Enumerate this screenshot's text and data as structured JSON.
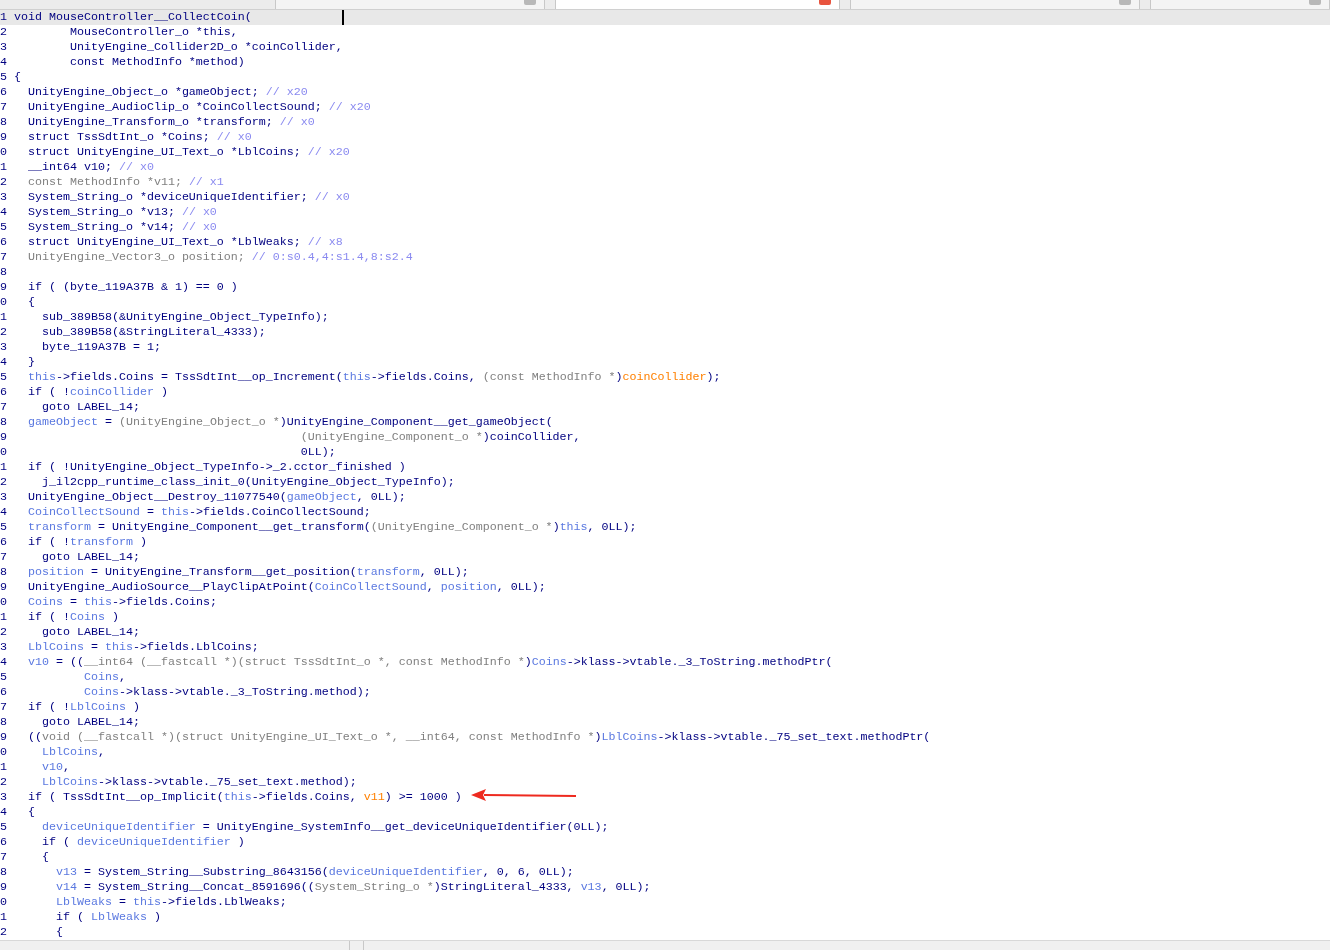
{
  "tabs": [
    {
      "selected": false
    },
    {
      "selected": true
    },
    {
      "selected": false
    },
    {
      "selected": false
    }
  ],
  "lines": [
    {
      "number": "1",
      "current": true,
      "segments": [
        {
          "kind": "plain",
          "text": "void MouseController__CollectCoin("
        }
      ]
    },
    {
      "number": "2",
      "current": false,
      "segments": [
        {
          "kind": "plain",
          "text": "        MouseController_o *this,"
        }
      ]
    },
    {
      "number": "3",
      "current": false,
      "segments": [
        {
          "kind": "plain",
          "text": "        UnityEngine_Collider2D_o *coinCollider,"
        }
      ]
    },
    {
      "number": "4",
      "current": false,
      "segments": [
        {
          "kind": "plain",
          "text": "        const MethodInfo *method)"
        }
      ]
    },
    {
      "number": "5",
      "current": false,
      "segments": [
        {
          "kind": "plain",
          "text": "{"
        }
      ]
    },
    {
      "number": "6",
      "current": false,
      "segments": [
        {
          "kind": "plain",
          "text": "  UnityEngine_Object_o *gameObject; "
        },
        {
          "kind": "comment",
          "text": "// x20"
        }
      ]
    },
    {
      "number": "7",
      "current": false,
      "segments": [
        {
          "kind": "plain",
          "text": "  UnityEngine_AudioClip_o *CoinCollectSound; "
        },
        {
          "kind": "comment",
          "text": "// x20"
        }
      ]
    },
    {
      "number": "8",
      "current": false,
      "segments": [
        {
          "kind": "plain",
          "text": "  UnityEngine_Transform_o *transform; "
        },
        {
          "kind": "comment",
          "text": "// x0"
        }
      ]
    },
    {
      "number": "9",
      "current": false,
      "segments": [
        {
          "kind": "plain",
          "text": "  struct TssSdtInt_o *Coins; "
        },
        {
          "kind": "comment",
          "text": "// x0"
        }
      ]
    },
    {
      "number": "0",
      "current": false,
      "segments": [
        {
          "kind": "plain",
          "text": "  struct UnityEngine_UI_Text_o *LblCoins; "
        },
        {
          "kind": "comment",
          "text": "// x20"
        }
      ]
    },
    {
      "number": "1",
      "current": false,
      "segments": [
        {
          "kind": "plain",
          "text": "  __int64 v10; "
        },
        {
          "kind": "comment",
          "text": "// x0"
        }
      ]
    },
    {
      "number": "2",
      "current": false,
      "segments": [
        {
          "kind": "gray",
          "text": "  const MethodInfo *v11; "
        },
        {
          "kind": "comment",
          "text": "// x1"
        }
      ]
    },
    {
      "number": "3",
      "current": false,
      "segments": [
        {
          "kind": "plain",
          "text": "  System_String_o *deviceUniqueIdentifier; "
        },
        {
          "kind": "comment",
          "text": "// x0"
        }
      ]
    },
    {
      "number": "4",
      "current": false,
      "segments": [
        {
          "kind": "plain",
          "text": "  System_String_o *v13; "
        },
        {
          "kind": "comment",
          "text": "// x0"
        }
      ]
    },
    {
      "number": "5",
      "current": false,
      "segments": [
        {
          "kind": "plain",
          "text": "  System_String_o *v14; "
        },
        {
          "kind": "comment",
          "text": "// x0"
        }
      ]
    },
    {
      "number": "6",
      "current": false,
      "segments": [
        {
          "kind": "plain",
          "text": "  struct UnityEngine_UI_Text_o *LblWeaks; "
        },
        {
          "kind": "comment",
          "text": "// x8"
        }
      ]
    },
    {
      "number": "7",
      "current": false,
      "segments": [
        {
          "kind": "gray",
          "text": "  UnityEngine_Vector3_o position; "
        },
        {
          "kind": "comment",
          "text": "// 0:s0.4,4:s1.4,8:s2.4"
        }
      ]
    },
    {
      "number": "8",
      "current": false
    },
    {
      "number": "9",
      "current": false,
      "segments": [
        {
          "kind": "plain",
          "text": "  if ( (byte_119A37B & 1) == 0 )"
        }
      ]
    },
    {
      "number": "0",
      "current": false,
      "segments": [
        {
          "kind": "plain",
          "text": "  {"
        }
      ]
    },
    {
      "number": "1",
      "current": false,
      "segments": [
        {
          "kind": "plain",
          "text": "    sub_389B58(&UnityEngine_Object_TypeInfo);"
        }
      ]
    },
    {
      "number": "2",
      "current": false,
      "segments": [
        {
          "kind": "plain",
          "text": "    sub_389B58(&StringLiteral_4333);"
        }
      ]
    },
    {
      "number": "3",
      "current": false,
      "segments": [
        {
          "kind": "plain",
          "text": "    byte_119A37B = 1;"
        }
      ]
    },
    {
      "number": "4",
      "current": false,
      "segments": [
        {
          "kind": "plain",
          "text": "  }"
        }
      ]
    },
    {
      "number": "5",
      "current": false,
      "segments": [
        {
          "kind": "local",
          "text": "  this"
        },
        {
          "kind": "plain",
          "text": "->fields.Coins = TssSdtInt__op_Increment("
        },
        {
          "kind": "local",
          "text": "this"
        },
        {
          "kind": "plain",
          "text": "->fields.Coins, "
        },
        {
          "kind": "gray",
          "text": "(const MethodInfo *"
        },
        {
          "kind": "plain",
          "text": ")"
        },
        {
          "kind": "arg",
          "text": "coinCollider"
        },
        {
          "kind": "plain",
          "text": ");"
        }
      ]
    },
    {
      "number": "6",
      "current": false,
      "segments": [
        {
          "kind": "plain",
          "text": "  if ( !"
        },
        {
          "kind": "local",
          "text": "coinCollider"
        },
        {
          "kind": "plain",
          "text": " )"
        }
      ]
    },
    {
      "number": "7",
      "current": false,
      "segments": [
        {
          "kind": "plain",
          "text": "    goto LABEL_14;"
        }
      ]
    },
    {
      "number": "8",
      "current": false,
      "segments": [
        {
          "kind": "local",
          "text": "  gameObject"
        },
        {
          "kind": "plain",
          "text": " = "
        },
        {
          "kind": "gray",
          "text": "(UnityEngine_Object_o *"
        },
        {
          "kind": "plain",
          "text": ")UnityEngine_Component__get_gameObject("
        }
      ]
    },
    {
      "number": "9",
      "current": false,
      "segments": [
        {
          "kind": "gray",
          "text": "                                         (UnityEngine_Component_o *"
        },
        {
          "kind": "plain",
          "text": ")coinCollider,"
        }
      ]
    },
    {
      "number": "0",
      "current": false,
      "segments": [
        {
          "kind": "plain",
          "text": "                                         0LL);"
        }
      ]
    },
    {
      "number": "1",
      "current": false,
      "segments": [
        {
          "kind": "plain",
          "text": "  if ( !UnityEngine_Object_TypeInfo->_2.cctor_finished )"
        }
      ]
    },
    {
      "number": "2",
      "current": false,
      "segments": [
        {
          "kind": "plain",
          "text": "    j_il2cpp_runtime_class_init_0(UnityEngine_Object_TypeInfo);"
        }
      ]
    },
    {
      "number": "3",
      "current": false,
      "segments": [
        {
          "kind": "plain",
          "text": "  UnityEngine_Object__Destroy_11077540("
        },
        {
          "kind": "local",
          "text": "gameObject"
        },
        {
          "kind": "plain",
          "text": ", 0LL);"
        }
      ]
    },
    {
      "number": "4",
      "current": false,
      "segments": [
        {
          "kind": "local",
          "text": "  CoinCollectSound"
        },
        {
          "kind": "plain",
          "text": " = "
        },
        {
          "kind": "local",
          "text": "this"
        },
        {
          "kind": "plain",
          "text": "->fields.CoinCollectSound;"
        }
      ]
    },
    {
      "number": "5",
      "current": false,
      "segments": [
        {
          "kind": "local",
          "text": "  transform"
        },
        {
          "kind": "plain",
          "text": " = UnityEngine_Component__get_transform("
        },
        {
          "kind": "gray",
          "text": "(UnityEngine_Component_o *"
        },
        {
          "kind": "plain",
          "text": ")"
        },
        {
          "kind": "local",
          "text": "this"
        },
        {
          "kind": "plain",
          "text": ", 0LL);"
        }
      ]
    },
    {
      "number": "6",
      "current": false,
      "segments": [
        {
          "kind": "plain",
          "text": "  if ( !"
        },
        {
          "kind": "local",
          "text": "transform"
        },
        {
          "kind": "plain",
          "text": " )"
        }
      ]
    },
    {
      "number": "7",
      "current": false,
      "segments": [
        {
          "kind": "plain",
          "text": "    goto LABEL_14;"
        }
      ]
    },
    {
      "number": "8",
      "current": false,
      "segments": [
        {
          "kind": "local",
          "text": "  position"
        },
        {
          "kind": "plain",
          "text": " = UnityEngine_Transform__get_position("
        },
        {
          "kind": "local",
          "text": "transform"
        },
        {
          "kind": "plain",
          "text": ", 0LL);"
        }
      ]
    },
    {
      "number": "9",
      "current": false,
      "segments": [
        {
          "kind": "plain",
          "text": "  UnityEngine_AudioSource__PlayClipAtPoint("
        },
        {
          "kind": "local",
          "text": "CoinCollectSound"
        },
        {
          "kind": "plain",
          "text": ", "
        },
        {
          "kind": "local",
          "text": "position"
        },
        {
          "kind": "plain",
          "text": ", 0LL);"
        }
      ]
    },
    {
      "number": "0",
      "current": false,
      "segments": [
        {
          "kind": "local",
          "text": "  Coins"
        },
        {
          "kind": "plain",
          "text": " = "
        },
        {
          "kind": "local",
          "text": "this"
        },
        {
          "kind": "plain",
          "text": "->fields.Coins;"
        }
      ]
    },
    {
      "number": "1",
      "current": false,
      "segments": [
        {
          "kind": "plain",
          "text": "  if ( !"
        },
        {
          "kind": "local",
          "text": "Coins"
        },
        {
          "kind": "plain",
          "text": " )"
        }
      ]
    },
    {
      "number": "2",
      "current": false,
      "segments": [
        {
          "kind": "plain",
          "text": "    goto LABEL_14;"
        }
      ]
    },
    {
      "number": "3",
      "current": false,
      "segments": [
        {
          "kind": "local",
          "text": "  LblCoins"
        },
        {
          "kind": "plain",
          "text": " = "
        },
        {
          "kind": "local",
          "text": "this"
        },
        {
          "kind": "plain",
          "text": "->fields.LblCoins;"
        }
      ]
    },
    {
      "number": "4",
      "current": false,
      "segments": [
        {
          "kind": "local",
          "text": "  v10"
        },
        {
          "kind": "plain",
          "text": " = (("
        },
        {
          "kind": "gray",
          "text": "__int64 (__fastcall *)(struct TssSdtInt_o *, const MethodInfo *"
        },
        {
          "kind": "plain",
          "text": ")"
        },
        {
          "kind": "local",
          "text": "Coins"
        },
        {
          "kind": "plain",
          "text": "->klass->vtable._3_ToString.methodPtr("
        }
      ]
    },
    {
      "number": "5",
      "current": false,
      "segments": [
        {
          "kind": "local",
          "text": "          Coins"
        },
        {
          "kind": "plain",
          "text": ","
        }
      ]
    },
    {
      "number": "6",
      "current": false,
      "segments": [
        {
          "kind": "local",
          "text": "          Coins"
        },
        {
          "kind": "plain",
          "text": "->klass->vtable._3_ToString.method);"
        }
      ]
    },
    {
      "number": "7",
      "current": false,
      "segments": [
        {
          "kind": "plain",
          "text": "  if ( !"
        },
        {
          "kind": "local",
          "text": "LblCoins"
        },
        {
          "kind": "plain",
          "text": " )"
        }
      ]
    },
    {
      "number": "8",
      "current": false,
      "segments": [
        {
          "kind": "plain",
          "text": "    goto LABEL_14;"
        }
      ]
    },
    {
      "number": "9",
      "current": false,
      "segments": [
        {
          "kind": "plain",
          "text": "  (("
        },
        {
          "kind": "gray",
          "text": "void (__fastcall *)(struct UnityEngine_UI_Text_o *, __int64, const MethodInfo *"
        },
        {
          "kind": "plain",
          "text": ")"
        },
        {
          "kind": "local",
          "text": "LblCoins"
        },
        {
          "kind": "plain",
          "text": "->klass->vtable._75_set_text.methodPtr("
        }
      ]
    },
    {
      "number": "0",
      "current": false,
      "segments": [
        {
          "kind": "local",
          "text": "    LblCoins"
        },
        {
          "kind": "plain",
          "text": ","
        }
      ]
    },
    {
      "number": "1",
      "current": false,
      "segments": [
        {
          "kind": "local",
          "text": "    v10"
        },
        {
          "kind": "plain",
          "text": ","
        }
      ]
    },
    {
      "number": "2",
      "current": false,
      "segments": [
        {
          "kind": "local",
          "text": "    LblCoins"
        },
        {
          "kind": "plain",
          "text": "->klass->vtable._75_set_text.method);"
        }
      ]
    },
    {
      "number": "3",
      "current": false,
      "segments": [
        {
          "kind": "plain",
          "text": "  if ( TssSdtInt__op_Implicit("
        },
        {
          "kind": "local",
          "text": "this"
        },
        {
          "kind": "plain",
          "text": "->fields.Coins, "
        },
        {
          "kind": "arg",
          "text": "v11"
        },
        {
          "kind": "plain",
          "text": ") >= 1000 )"
        }
      ]
    },
    {
      "number": "4",
      "current": false,
      "segments": [
        {
          "kind": "plain",
          "text": "  {"
        }
      ]
    },
    {
      "number": "5",
      "current": false,
      "segments": [
        {
          "kind": "local",
          "text": "    deviceUniqueIdentifier"
        },
        {
          "kind": "plain",
          "text": " = UnityEngine_SystemInfo__get_deviceUniqueIdentifier(0LL);"
        }
      ]
    },
    {
      "number": "6",
      "current": false,
      "segments": [
        {
          "kind": "plain",
          "text": "    if ( "
        },
        {
          "kind": "local",
          "text": "deviceUniqueIdentifier"
        },
        {
          "kind": "plain",
          "text": " )"
        }
      ]
    },
    {
      "number": "7",
      "current": false,
      "segments": [
        {
          "kind": "plain",
          "text": "    {"
        }
      ]
    },
    {
      "number": "8",
      "current": false,
      "segments": [
        {
          "kind": "local",
          "text": "      v13"
        },
        {
          "kind": "plain",
          "text": " = System_String__Substring_8643156("
        },
        {
          "kind": "local",
          "text": "deviceUniqueIdentifier"
        },
        {
          "kind": "plain",
          "text": ", 0, 6, 0LL);"
        }
      ]
    },
    {
      "number": "9",
      "current": false,
      "segments": [
        {
          "kind": "local",
          "text": "      v14"
        },
        {
          "kind": "plain",
          "text": " = System_String__Concat_8591696(("
        },
        {
          "kind": "gray",
          "text": "System_String_o *"
        },
        {
          "kind": "plain",
          "text": ")StringLiteral_4333, "
        },
        {
          "kind": "local",
          "text": "v13"
        },
        {
          "kind": "plain",
          "text": ", 0LL);"
        }
      ]
    },
    {
      "number": "0",
      "current": false,
      "segments": [
        {
          "kind": "local",
          "text": "      LblWeaks"
        },
        {
          "kind": "plain",
          "text": " = "
        },
        {
          "kind": "local",
          "text": "this"
        },
        {
          "kind": "plain",
          "text": "->fields.LblWeaks;"
        }
      ]
    },
    {
      "number": "1",
      "current": false,
      "segments": [
        {
          "kind": "plain",
          "text": "      if ( "
        },
        {
          "kind": "local",
          "text": "LblWeaks"
        },
        {
          "kind": "plain",
          "text": " )"
        }
      ]
    },
    {
      "number": "2",
      "current": false,
      "segments": [
        {
          "kind": "plain",
          "text": "      {"
        }
      ]
    }
  ]
}
